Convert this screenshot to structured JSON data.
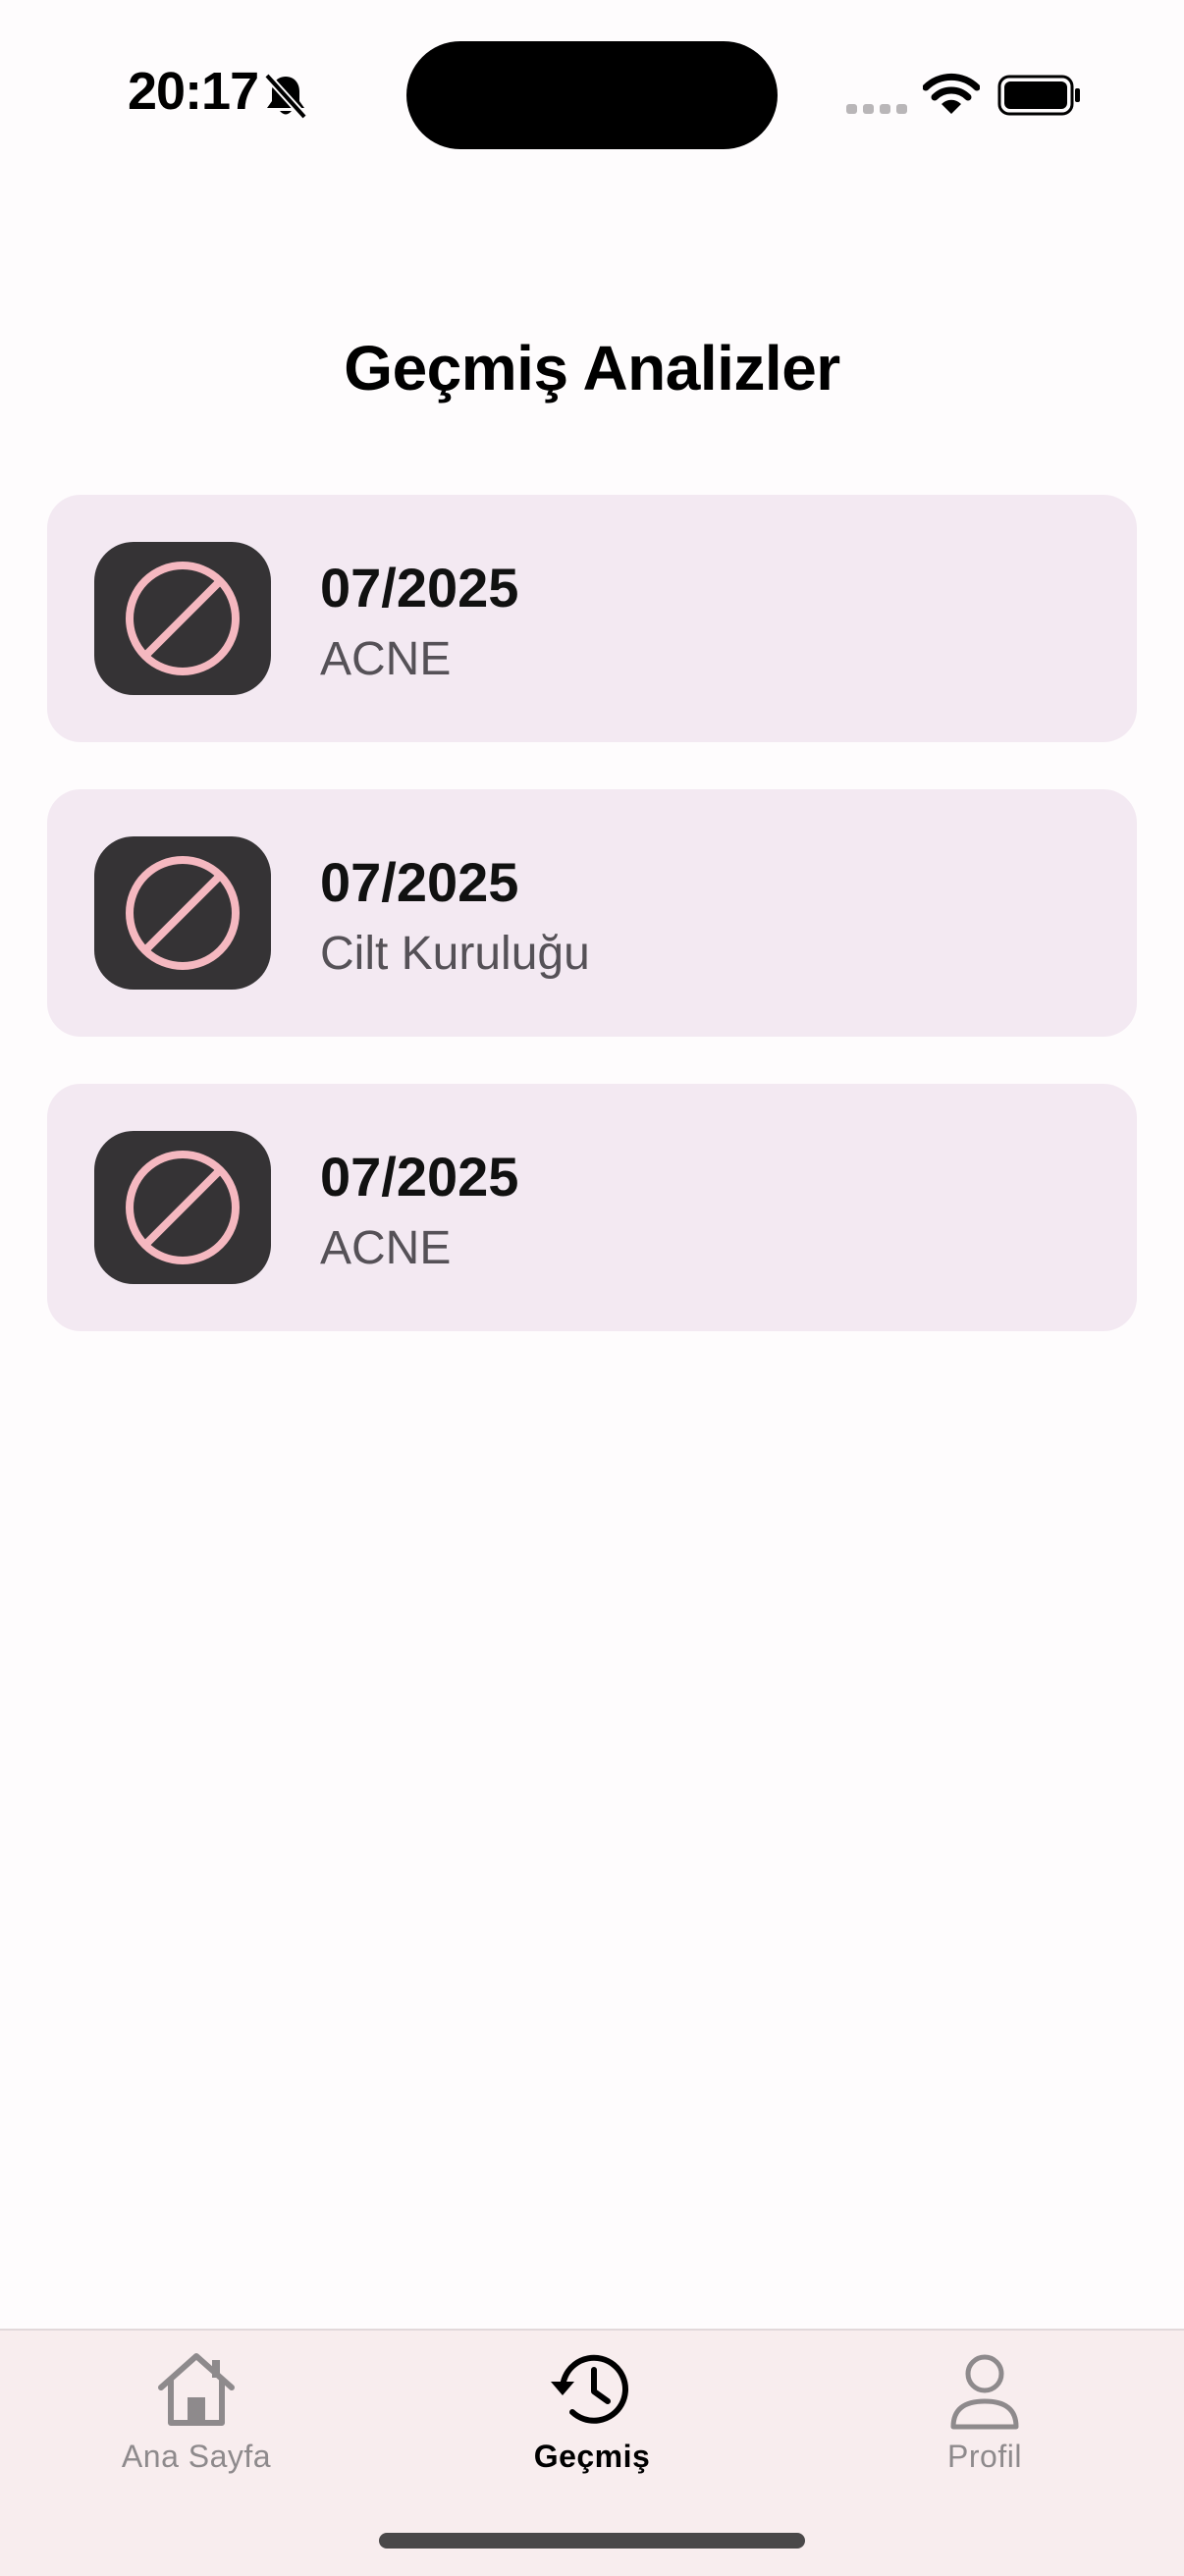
{
  "status_bar": {
    "time": "20:17",
    "icons": [
      "bell-slash-icon",
      "signal-icon",
      "wifi-icon",
      "battery-icon"
    ]
  },
  "page": {
    "title": "Geçmiş Analizler"
  },
  "analyses": [
    {
      "date": "07/2025",
      "label": "ACNE",
      "icon": "prohibited-icon"
    },
    {
      "date": "07/2025",
      "label": "Cilt Kuruluğu",
      "icon": "prohibited-icon"
    },
    {
      "date": "07/2025",
      "label": "ACNE",
      "icon": "prohibited-icon"
    }
  ],
  "tab_bar": {
    "tabs": [
      {
        "label": "Ana Sayfa",
        "icon": "home-icon",
        "active": false
      },
      {
        "label": "Geçmiş",
        "icon": "history-icon",
        "active": true
      },
      {
        "label": "Profil",
        "icon": "person-icon",
        "active": false
      }
    ]
  },
  "colors": {
    "card_background": "#f3e9f2",
    "thumb_background": "#353335",
    "prohibited_symbol": "#f5b8c0",
    "tab_bar_background": "#f8edee",
    "inactive_tab": "#8e8a8c",
    "active_tab": "#000000"
  }
}
